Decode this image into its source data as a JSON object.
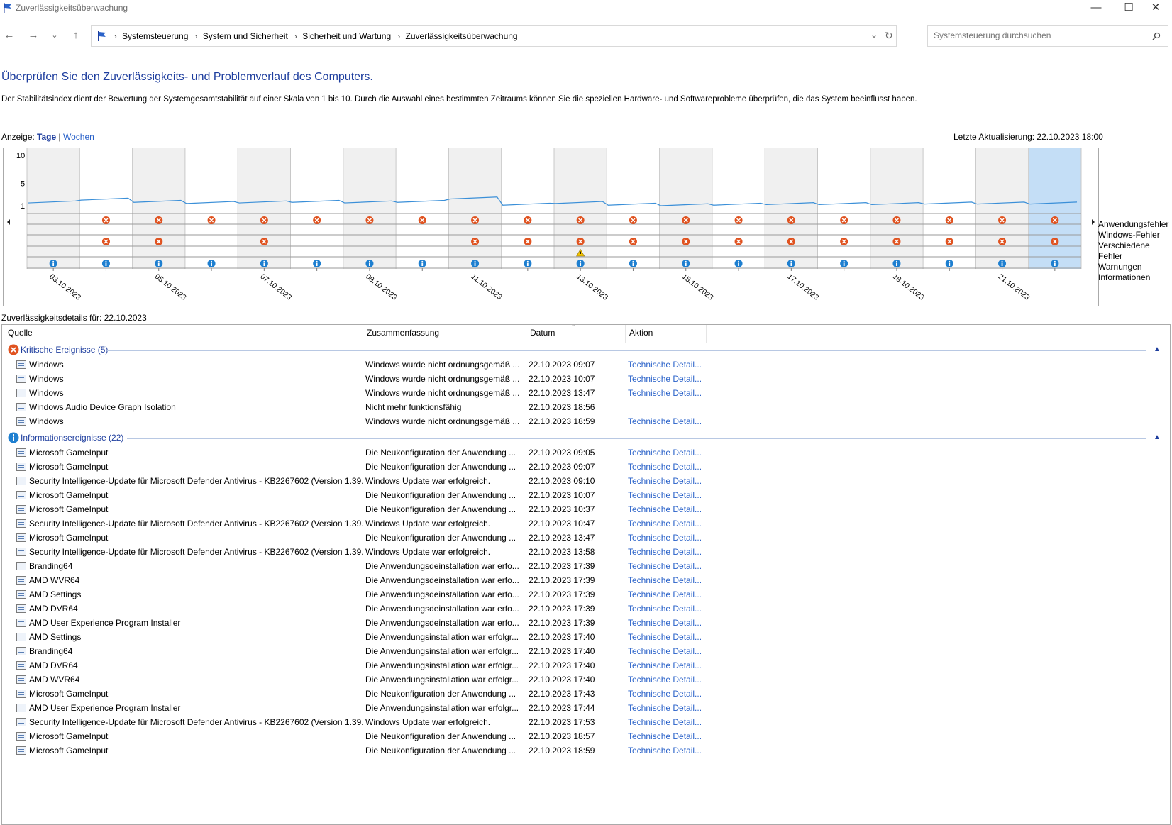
{
  "window": {
    "title": "Zuverlässigkeitsüberwachung",
    "minimize": "—",
    "maximize": "☐",
    "close": "✕"
  },
  "address": {
    "breadcrumbs": [
      "Systemsteuerung",
      "System und Sicherheit",
      "Sicherheit und Wartung",
      "Zuverlässigkeitsüberwachung"
    ],
    "search_placeholder": "Systemsteuerung durchsuchen"
  },
  "page": {
    "heading": "Überprüfen Sie den Zuverlässigkeits- und Problemverlauf des Computers.",
    "description": "Der Stabilitätsindex dient der Bewertung der Systemgesamtstabilität auf einer Skala von 1 bis 10. Durch die Auswahl eines bestimmten Zeitraums können Sie die speziellen Hardware- und Softwareprobleme überprüfen, die das System beeinflusst haben.",
    "view_label": "Anzeige:",
    "view_days": "Tage",
    "view_sep": "|",
    "view_weeks": "Wochen",
    "last_update": "Letzte Aktualisierung: 22.10.2023 18:00",
    "details_label": "Zuverlässigkeitsdetails für: 22.10.2023"
  },
  "chart_data": {
    "type": "line",
    "y_ticks": [
      "10",
      "5",
      "1"
    ],
    "ylim": [
      1,
      10
    ],
    "x_labels": [
      "03.10.2023",
      "05.10.2023",
      "07.10.2023",
      "09.10.2023",
      "11.10.2023",
      "13.10.2023",
      "15.10.2023",
      "17.10.2023",
      "19.10.2023",
      "21.10.2023"
    ],
    "days": [
      "03.10.2023",
      "04.10.2023",
      "05.10.2023",
      "06.10.2023",
      "07.10.2023",
      "08.10.2023",
      "09.10.2023",
      "10.10.2023",
      "11.10.2023",
      "12.10.2023",
      "13.10.2023",
      "14.10.2023",
      "15.10.2023",
      "16.10.2023",
      "17.10.2023",
      "18.10.2023",
      "19.10.2023",
      "20.10.2023",
      "21.10.2023",
      "22.10.2023"
    ],
    "stability_index": [
      1.5,
      2.0,
      1.6,
      1.4,
      1.5,
      1.6,
      1.5,
      1.6,
      2.2,
      1.1,
      1.4,
      1.1,
      1.0,
      1.1,
      1.2,
      1.2,
      1.2,
      1.3,
      1.3,
      1.3
    ],
    "selected_day": "22.10.2023",
    "rows": [
      "Anwendungsfehler",
      "Windows-Fehler",
      "Verschiedene Fehler",
      "Warnungen",
      "Informationen"
    ],
    "application_errors": [
      0,
      1,
      1,
      1,
      1,
      1,
      1,
      1,
      1,
      1,
      1,
      1,
      1,
      1,
      1,
      1,
      1,
      1,
      1,
      1
    ],
    "windows_errors": [
      0,
      0,
      0,
      0,
      0,
      0,
      0,
      0,
      0,
      0,
      0,
      0,
      0,
      0,
      0,
      0,
      0,
      0,
      0,
      0
    ],
    "misc_errors": [
      0,
      1,
      1,
      0,
      1,
      0,
      0,
      0,
      1,
      1,
      1,
      1,
      1,
      1,
      1,
      1,
      1,
      1,
      1,
      1
    ],
    "warnings": [
      0,
      0,
      0,
      0,
      0,
      0,
      0,
      0,
      0,
      0,
      1,
      0,
      0,
      0,
      0,
      0,
      0,
      0,
      0,
      0
    ],
    "information": [
      1,
      1,
      1,
      1,
      1,
      1,
      1,
      1,
      1,
      1,
      1,
      1,
      1,
      1,
      1,
      1,
      1,
      1,
      1,
      1
    ]
  },
  "legend": [
    "Anwendungsfehler",
    "Windows-Fehler",
    "Verschiedene Fehler",
    "Warnungen",
    "Informationen"
  ],
  "table": {
    "headers": [
      "Quelle",
      "Zusammenfassung",
      "Datum",
      "Aktion"
    ],
    "groups": [
      {
        "title": "Kritische Ereignisse (5)",
        "rows": [
          {
            "source": "Windows",
            "summary": "Windows wurde nicht ordnungsgemäß ...",
            "date": "22.10.2023 09:07",
            "action": "Technische Detail..."
          },
          {
            "source": "Windows",
            "summary": "Windows wurde nicht ordnungsgemäß ...",
            "date": "22.10.2023 10:07",
            "action": "Technische Detail..."
          },
          {
            "source": "Windows",
            "summary": "Windows wurde nicht ordnungsgemäß ...",
            "date": "22.10.2023 13:47",
            "action": "Technische Detail..."
          },
          {
            "source": "Windows Audio Device Graph Isolation",
            "summary": "Nicht mehr funktionsfähig",
            "date": "22.10.2023 18:56",
            "action": ""
          },
          {
            "source": "Windows",
            "summary": "Windows wurde nicht ordnungsgemäß ...",
            "date": "22.10.2023 18:59",
            "action": "Technische Detail..."
          }
        ]
      },
      {
        "title": "Informationsereignisse (22)",
        "rows": [
          {
            "source": "Microsoft GameInput",
            "summary": "Die Neukonfiguration der Anwendung ...",
            "date": "22.10.2023 09:05",
            "action": "Technische Detail..."
          },
          {
            "source": "Microsoft GameInput",
            "summary": "Die Neukonfiguration der Anwendung ...",
            "date": "22.10.2023 09:07",
            "action": "Technische Detail..."
          },
          {
            "source": "Security Intelligence-Update für Microsoft Defender Antivirus - KB2267602 (Version 1.39...",
            "summary": "Windows Update war erfolgreich.",
            "date": "22.10.2023 09:10",
            "action": "Technische Detail..."
          },
          {
            "source": "Microsoft GameInput",
            "summary": "Die Neukonfiguration der Anwendung ...",
            "date": "22.10.2023 10:07",
            "action": "Technische Detail..."
          },
          {
            "source": "Microsoft GameInput",
            "summary": "Die Neukonfiguration der Anwendung ...",
            "date": "22.10.2023 10:37",
            "action": "Technische Detail..."
          },
          {
            "source": "Security Intelligence-Update für Microsoft Defender Antivirus - KB2267602 (Version 1.39...",
            "summary": "Windows Update war erfolgreich.",
            "date": "22.10.2023 10:47",
            "action": "Technische Detail..."
          },
          {
            "source": "Microsoft GameInput",
            "summary": "Die Neukonfiguration der Anwendung ...",
            "date": "22.10.2023 13:47",
            "action": "Technische Detail..."
          },
          {
            "source": "Security Intelligence-Update für Microsoft Defender Antivirus - KB2267602 (Version 1.39...",
            "summary": "Windows Update war erfolgreich.",
            "date": "22.10.2023 13:58",
            "action": "Technische Detail..."
          },
          {
            "source": "Branding64",
            "summary": "Die Anwendungsdeinstallation war erfo...",
            "date": "22.10.2023 17:39",
            "action": "Technische Detail..."
          },
          {
            "source": "AMD WVR64",
            "summary": "Die Anwendungsdeinstallation war erfo...",
            "date": "22.10.2023 17:39",
            "action": "Technische Detail..."
          },
          {
            "source": "AMD Settings",
            "summary": "Die Anwendungsdeinstallation war erfo...",
            "date": "22.10.2023 17:39",
            "action": "Technische Detail..."
          },
          {
            "source": "AMD DVR64",
            "summary": "Die Anwendungsdeinstallation war erfo...",
            "date": "22.10.2023 17:39",
            "action": "Technische Detail..."
          },
          {
            "source": "AMD User Experience Program Installer",
            "summary": "Die Anwendungsdeinstallation war erfo...",
            "date": "22.10.2023 17:39",
            "action": "Technische Detail..."
          },
          {
            "source": "AMD Settings",
            "summary": "Die Anwendungsinstallation war erfolgr...",
            "date": "22.10.2023 17:40",
            "action": "Technische Detail..."
          },
          {
            "source": "Branding64",
            "summary": "Die Anwendungsinstallation war erfolgr...",
            "date": "22.10.2023 17:40",
            "action": "Technische Detail..."
          },
          {
            "source": "AMD DVR64",
            "summary": "Die Anwendungsinstallation war erfolgr...",
            "date": "22.10.2023 17:40",
            "action": "Technische Detail..."
          },
          {
            "source": "AMD WVR64",
            "summary": "Die Anwendungsinstallation war erfolgr...",
            "date": "22.10.2023 17:40",
            "action": "Technische Detail..."
          },
          {
            "source": "Microsoft GameInput",
            "summary": "Die Neukonfiguration der Anwendung ...",
            "date": "22.10.2023 17:43",
            "action": "Technische Detail..."
          },
          {
            "source": "AMD User Experience Program Installer",
            "summary": "Die Anwendungsinstallation war erfolgr...",
            "date": "22.10.2023 17:44",
            "action": "Technische Detail..."
          },
          {
            "source": "Security Intelligence-Update für Microsoft Defender Antivirus - KB2267602 (Version 1.39...",
            "summary": "Windows Update war erfolgreich.",
            "date": "22.10.2023 17:53",
            "action": "Technische Detail..."
          },
          {
            "source": "Microsoft GameInput",
            "summary": "Die Neukonfiguration der Anwendung ...",
            "date": "22.10.2023 18:57",
            "action": "Technische Detail..."
          },
          {
            "source": "Microsoft GameInput",
            "summary": "Die Neukonfiguration der Anwendung ...",
            "date": "22.10.2023 18:59",
            "action": "Technische Detail..."
          }
        ]
      }
    ]
  },
  "colors": {
    "link": "#2a62c9",
    "heading": "#1e3e9e",
    "line": "#3a8fd8",
    "selected": "#c4def6",
    "band": "#f0f0f0",
    "error": "#e0521f",
    "info": "#1e7fd0",
    "warning": "#f5c400"
  }
}
